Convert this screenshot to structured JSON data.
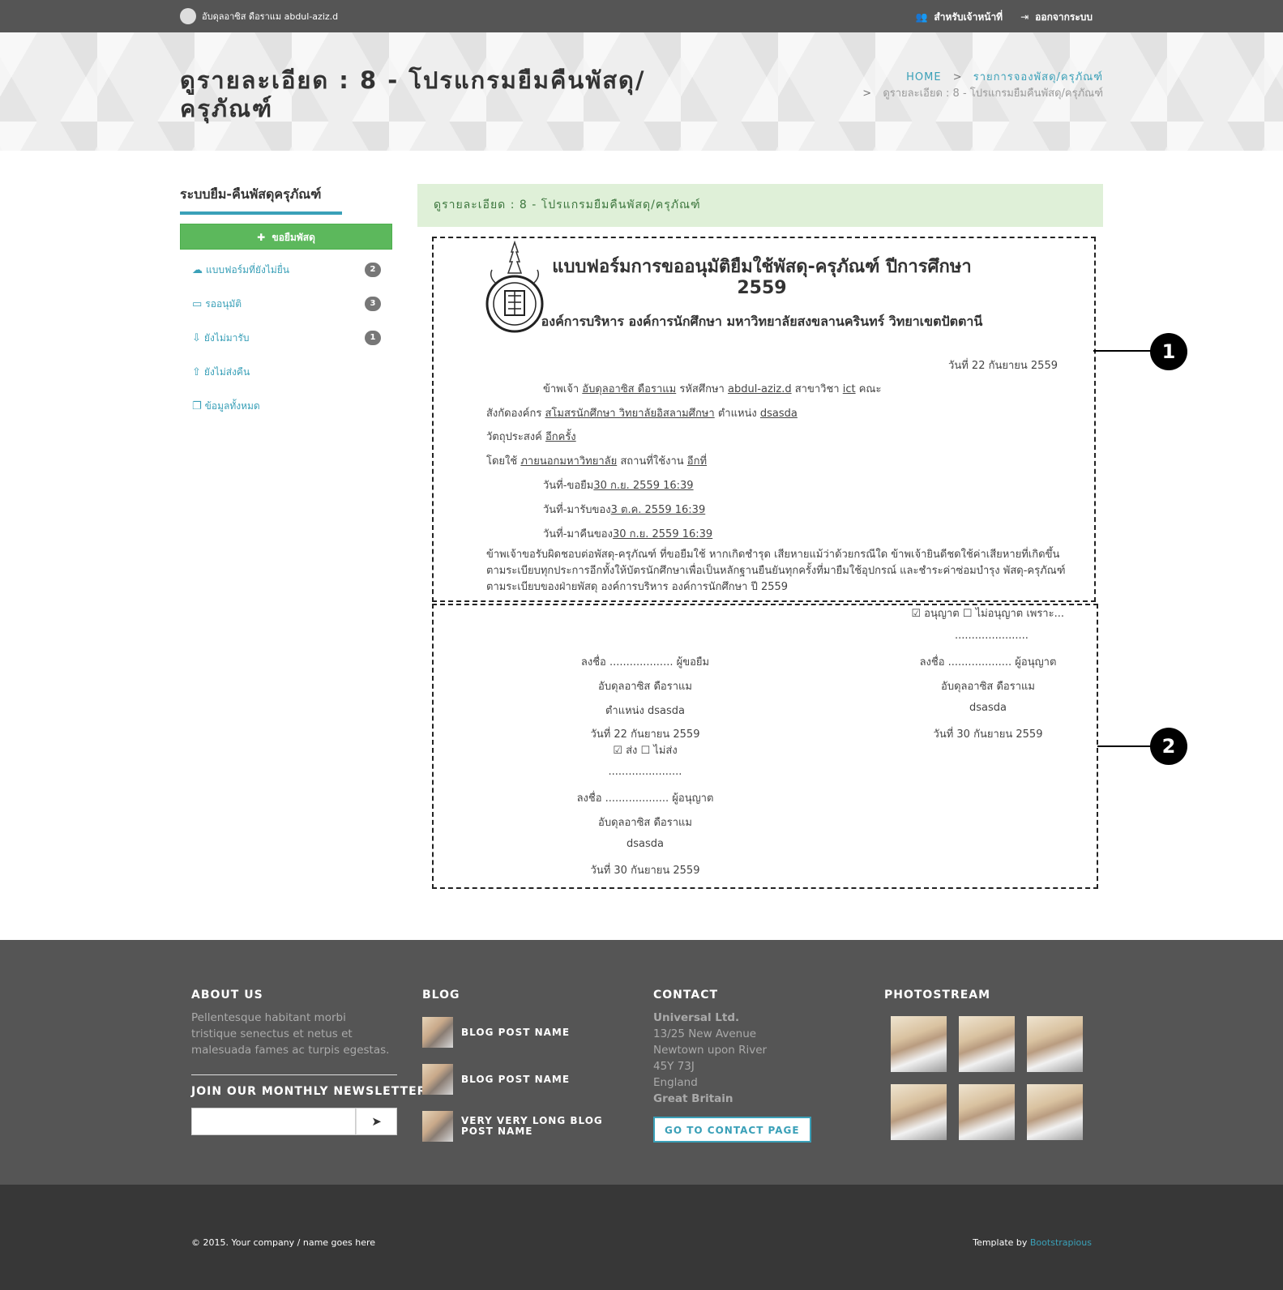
{
  "topbar": {
    "user": "อับดุลอาซิส ดือราแม abdul-aziz.d",
    "staff_link": "สำหรับเจ้าหน้าที่",
    "logout_link": "ออกจากระบบ"
  },
  "header": {
    "title": "ดูรายละเอียด : 8 - โปรแกรมยืมคืนพัสดุ/ครุภัณฑ์",
    "breadcrumb_home": "HOME",
    "breadcrumb_sep": ">",
    "breadcrumb_list": "รายการจองพัสดุ/ครุภัณฑ์",
    "breadcrumb_current": "ดูรายละเอียด : 8 - โปรแกรมยืมคืนพัสดุ/ครุภัณฑ์"
  },
  "sidebar": {
    "title": "ระบบยืม-คืนพัสดุครุภัณฑ์",
    "borrow_button": "ขอยืมพัสดุ",
    "items": [
      {
        "label": "แบบฟอร์มที่ยังไม่ยื่น",
        "badge": "2",
        "icon": "cloud-upload-icon"
      },
      {
        "label": "รออนุมัติ",
        "badge": "3",
        "icon": "inbox-icon"
      },
      {
        "label": "ยังไม่มารับ",
        "badge": "1",
        "icon": "user-download-icon"
      },
      {
        "label": "ยังไม่ส่งคืน",
        "badge": "",
        "icon": "user-upload-icon"
      },
      {
        "label": "ข้อมูลทั้งหมด",
        "badge": "",
        "icon": "files-icon"
      }
    ]
  },
  "main": {
    "alert": "ดูรายละเอียด : 8 - โปรแกรมยืมคืนพัสดุ/ครุภัณฑ์",
    "form": {
      "title": "แบบฟอร์มการขออนุมัติยืมใช้พัสดุ-ครุภัณฑ์ ปีการศึกษา 2559",
      "org": "องค์การบริหาร องค์การนักศึกษา มหาวิทยาลัยสงขลานครินทร์ วิทยาเขตปัตตานี",
      "date": "วันที่ 22 กันยายน 2559",
      "l1_a": "ข้าพเจ้า",
      "l1_name": "อับดุลอาซิส ดือราแม",
      "l1_b": "รหัสศึกษา",
      "l1_id": "abdul-aziz.d",
      "l1_c": "สาขาวิชา",
      "l1_major": "ict",
      "l1_d": "คณะ",
      "l2_a": "สังกัดองค์กร",
      "l2_org": "สโมสรนักศึกษา วิทยาลัยอิสลามศึกษา",
      "l2_b": "ตำแหน่ง",
      "l2_pos": "dsasda",
      "l3_a": "วัตถุประสงค์",
      "l3_val": "อีกครั้ง",
      "l4_a": "โดยใช้",
      "l4_val": "ภายนอกมหาวิทยาลัย",
      "l4_b": "สถานที่ใช้งาน",
      "l4_place": "อีกที่",
      "l5_a": "วันที่-ขอยืม",
      "l5_val": "30 ก.ย. 2559 16:39",
      "l6_a": "วันที่-มารับของ",
      "l6_val": "3 ต.ค. 2559 16:39",
      "l7_a": "วันที่-มาคืนของ",
      "l7_val": "30 ก.ย. 2559 16:39",
      "paragraph": "ข้าพเจ้าขอรับผิดชอบต่อพัสดุ-ครุภัณฑ์ ที่ขอยืมใช้ หากเกิดชำรุด เสียหายแม้ว่าด้วยกรณีใด ข้าพเจ้ายินดีชดใช้ค่าเสียหายที่เกิดขึ้น ตามระเบียบทุกประการอีกทั้งให้บัตรนักศึกษาเพื่อเป็นหลักฐานยืนยันทุกครั้งที่มายืมใช้อุปกรณ์ และชำระค่าซ่อมบำรุง พัสดุ-ครุภัณฑ์ ตามระเบียบของฝ่ายพัสดุ องค์การบริหาร องค์การนักศึกษา ปี 2559"
    },
    "sign": {
      "approve_check": "☑ อนุญาต ☐ ไม่อนุญาต เพราะ...",
      "dots": "......................",
      "left_sign": "ลงชื่อ ................... ผู้ขอยืม",
      "left_name": "อับดุลอาซิส ดือราแม",
      "left_pos": "ตำแหน่ง dsasda",
      "left_date": "วันที่ 22 กันยายน 2559",
      "send_check": "☑ ส่ง ☐ ไม่ส่ง",
      "left2_dots": "......................",
      "left2_sign": "ลงชื่อ ................... ผู้อนุญาต",
      "left2_name": "อับดุลอาซิส ดือราแม",
      "left2_pos": "dsasda",
      "left2_date": "วันที่ 30 กันยายน 2559",
      "right_sign": "ลงชื่อ ................... ผู้อนุญาต",
      "right_name": "อับดุลอาซิส ดือราแม",
      "right_pos": "dsasda",
      "right_date": "วันที่ 30 กันยายน 2559"
    },
    "callouts": [
      "1",
      "2"
    ]
  },
  "footer": {
    "about_title": "ABOUT US",
    "about_text": "Pellentesque habitant morbi tristique senectus et netus et malesuada fames ac turpis egestas.",
    "newsletter_title": "JOIN OUR MONTHLY NEWSLETTER",
    "blog_title": "BLOG",
    "blog_posts": [
      "BLOG POST NAME",
      "BLOG POST NAME",
      "VERY VERY LONG BLOG POST NAME"
    ],
    "contact_title": "CONTACT",
    "contact_company": "Universal Ltd.",
    "contact_lines": [
      "13/25 New Avenue",
      "Newtown upon River",
      "45Y 73J",
      "England"
    ],
    "contact_country": "Great Britain",
    "contact_button": "GO TO CONTACT PAGE",
    "photostream_title": "PHOTOSTREAM",
    "copyright": "© 2015. Your company / name goes here",
    "template_by": "Template by",
    "template_link": "Bootstrapious"
  },
  "colors": {
    "accent": "#3aa0b8",
    "green": "#5cb85c",
    "dark": "#555555",
    "darker": "#373737"
  }
}
